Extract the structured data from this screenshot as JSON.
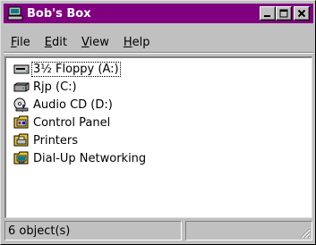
{
  "window": {
    "title": "Bob's Box",
    "controls": [
      "minimize-icon",
      "maximize-icon",
      "close-icon"
    ],
    "title_color": "#800080"
  },
  "menu": [
    {
      "pre": "",
      "key": "F",
      "post": "ile"
    },
    {
      "pre": "",
      "key": "E",
      "post": "dit"
    },
    {
      "pre": "",
      "key": "V",
      "post": "iew"
    },
    {
      "pre": "",
      "key": "H",
      "post": "elp"
    }
  ],
  "items": [
    {
      "label": "3½ Floppy (A:)",
      "icon": "floppy-drive-icon",
      "selected": true
    },
    {
      "label": "Rjp (C:)",
      "icon": "hard-drive-icon",
      "selected": false
    },
    {
      "label": "Audio CD (D:)",
      "icon": "cd-drive-icon",
      "selected": false
    },
    {
      "label": "Control Panel",
      "icon": "control-panel-icon",
      "selected": false
    },
    {
      "label": "Printers",
      "icon": "printers-icon",
      "selected": false
    },
    {
      "label": "Dial-Up Networking",
      "icon": "dial-up-networking-icon",
      "selected": false
    }
  ],
  "status": {
    "count_text": "6 object(s)"
  }
}
